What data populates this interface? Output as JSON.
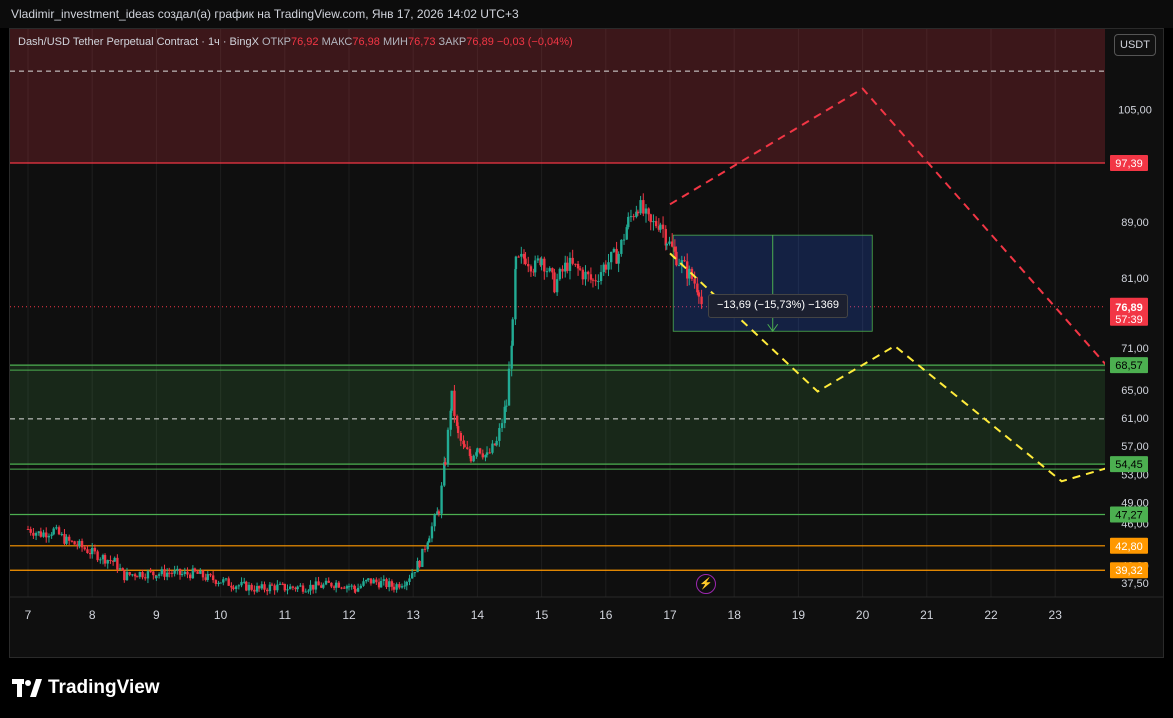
{
  "header": {
    "title": "Vladimir_investment_ideas создал(а) график на TradingView.com, Янв 17, 2026 14:02 UTC+3"
  },
  "legend": {
    "symbol": "Dash/USD Tether Perpetual Contract · 1ч · BingX",
    "open_label": "ОТКР",
    "open": "76,92",
    "high_label": "МАКС",
    "high": "76,98",
    "low_label": "МИН",
    "low": "76,73",
    "close_label": "ЗАКР",
    "close": "76,89",
    "change": "−0,03 (−0,04%)"
  },
  "currency": "USDT",
  "measure_label": "−13,69 (−15,73%) −1369",
  "brand": "TradingView",
  "colors": {
    "up": "#22ab94",
    "down": "#f23645",
    "red_zone": "#f23645",
    "green_zone": "#4caf50",
    "orange": "#ff9800",
    "yellow": "#ffeb3b",
    "measure_box": "#2962ff"
  },
  "chart_data": {
    "type": "candlestick",
    "symbol": "Dash/USD Tether Perpetual Contract",
    "interval": "1ч",
    "exchange": "BingX",
    "x_ticks": [
      "7",
      "8",
      "9",
      "10",
      "11",
      "12",
      "13",
      "14",
      "15",
      "16",
      "17",
      "18",
      "19",
      "20",
      "21",
      "22",
      "23"
    ],
    "y_ticks": [
      "105,00",
      "89,00",
      "81,00",
      "71,00",
      "65,00",
      "61,00",
      "57,00",
      "53,00",
      "49,00",
      "46,00",
      "40,00",
      "37,50"
    ],
    "ylim": [
      35.5,
      116.5
    ],
    "last_price": "76,89",
    "countdown": "57:39",
    "level_labels": [
      {
        "value": 97.39,
        "label": "97,39",
        "color": "red"
      },
      {
        "value": 68.57,
        "label": "68,57",
        "color": "green"
      },
      {
        "value": 54.45,
        "label": "54,45",
        "color": "green"
      },
      {
        "value": 47.27,
        "label": "47,27",
        "color": "green"
      },
      {
        "value": 42.8,
        "label": "42,80",
        "color": "orange"
      },
      {
        "value": 39.32,
        "label": "39,32",
        "color": "orange"
      }
    ],
    "price_path": [
      [
        7.0,
        45.2
      ],
      [
        7.2,
        44.5
      ],
      [
        7.4,
        45.0
      ],
      [
        7.6,
        43.5
      ],
      [
        7.8,
        42.8
      ],
      [
        8.0,
        41.8
      ],
      [
        8.2,
        41.0
      ],
      [
        8.35,
        40.5
      ],
      [
        8.5,
        38.5
      ],
      [
        8.7,
        38.9
      ],
      [
        9.0,
        38.8
      ],
      [
        9.2,
        39.0
      ],
      [
        9.4,
        38.7
      ],
      [
        9.6,
        38.9
      ],
      [
        9.8,
        38.2
      ],
      [
        10.0,
        37.8
      ],
      [
        10.2,
        37.3
      ],
      [
        10.4,
        37.0
      ],
      [
        10.6,
        36.6
      ],
      [
        10.8,
        37.0
      ],
      [
        11.0,
        36.8
      ],
      [
        11.2,
        36.9
      ],
      [
        11.4,
        37.0
      ],
      [
        11.6,
        37.1
      ],
      [
        11.8,
        37.5
      ],
      [
        12.0,
        37.1
      ],
      [
        12.1,
        36.6
      ],
      [
        12.3,
        37.8
      ],
      [
        12.5,
        37.5
      ],
      [
        12.7,
        37.0
      ],
      [
        12.9,
        38.0
      ],
      [
        13.1,
        40.5
      ],
      [
        13.25,
        44.5
      ],
      [
        13.4,
        48.0
      ],
      [
        13.5,
        55.0
      ],
      [
        13.6,
        64.0
      ],
      [
        13.7,
        58.5
      ],
      [
        13.8,
        56.5
      ],
      [
        13.9,
        55.5
      ],
      [
        14.0,
        57.0
      ],
      [
        14.15,
        55.5
      ],
      [
        14.3,
        57.5
      ],
      [
        14.45,
        63.0
      ],
      [
        14.55,
        74.0
      ],
      [
        14.6,
        83.0
      ],
      [
        14.75,
        84.0
      ],
      [
        14.9,
        82.5
      ],
      [
        15.0,
        84.0
      ],
      [
        15.2,
        80.0
      ],
      [
        15.4,
        83.0
      ],
      [
        15.6,
        82.0
      ],
      [
        15.8,
        80.5
      ],
      [
        16.0,
        83.0
      ],
      [
        16.2,
        84.5
      ],
      [
        16.35,
        89.0
      ],
      [
        16.5,
        91.5
      ],
      [
        16.7,
        88.5
      ],
      [
        16.85,
        89.0
      ],
      [
        16.95,
        86.5
      ],
      [
        17.1,
        84.0
      ],
      [
        17.3,
        81.5
      ],
      [
        17.45,
        79.5
      ],
      [
        17.5,
        76.9
      ]
    ],
    "measure": {
      "from": 87.1,
      "to": 73.4,
      "change": "−13,69",
      "percent": "−15,73%",
      "ticks": "−1369"
    },
    "forecast_paths": [
      {
        "color": "red",
        "points": [
          [
            17.0,
            91.5
          ],
          [
            20.0,
            108.0
          ],
          [
            23.85,
            68.0
          ]
        ]
      },
      {
        "color": "yellow",
        "points": [
          [
            17.0,
            84.5
          ],
          [
            19.3,
            64.8
          ],
          [
            20.5,
            71.3
          ],
          [
            23.1,
            52.0
          ],
          [
            23.85,
            54.0
          ]
        ]
      }
    ]
  }
}
